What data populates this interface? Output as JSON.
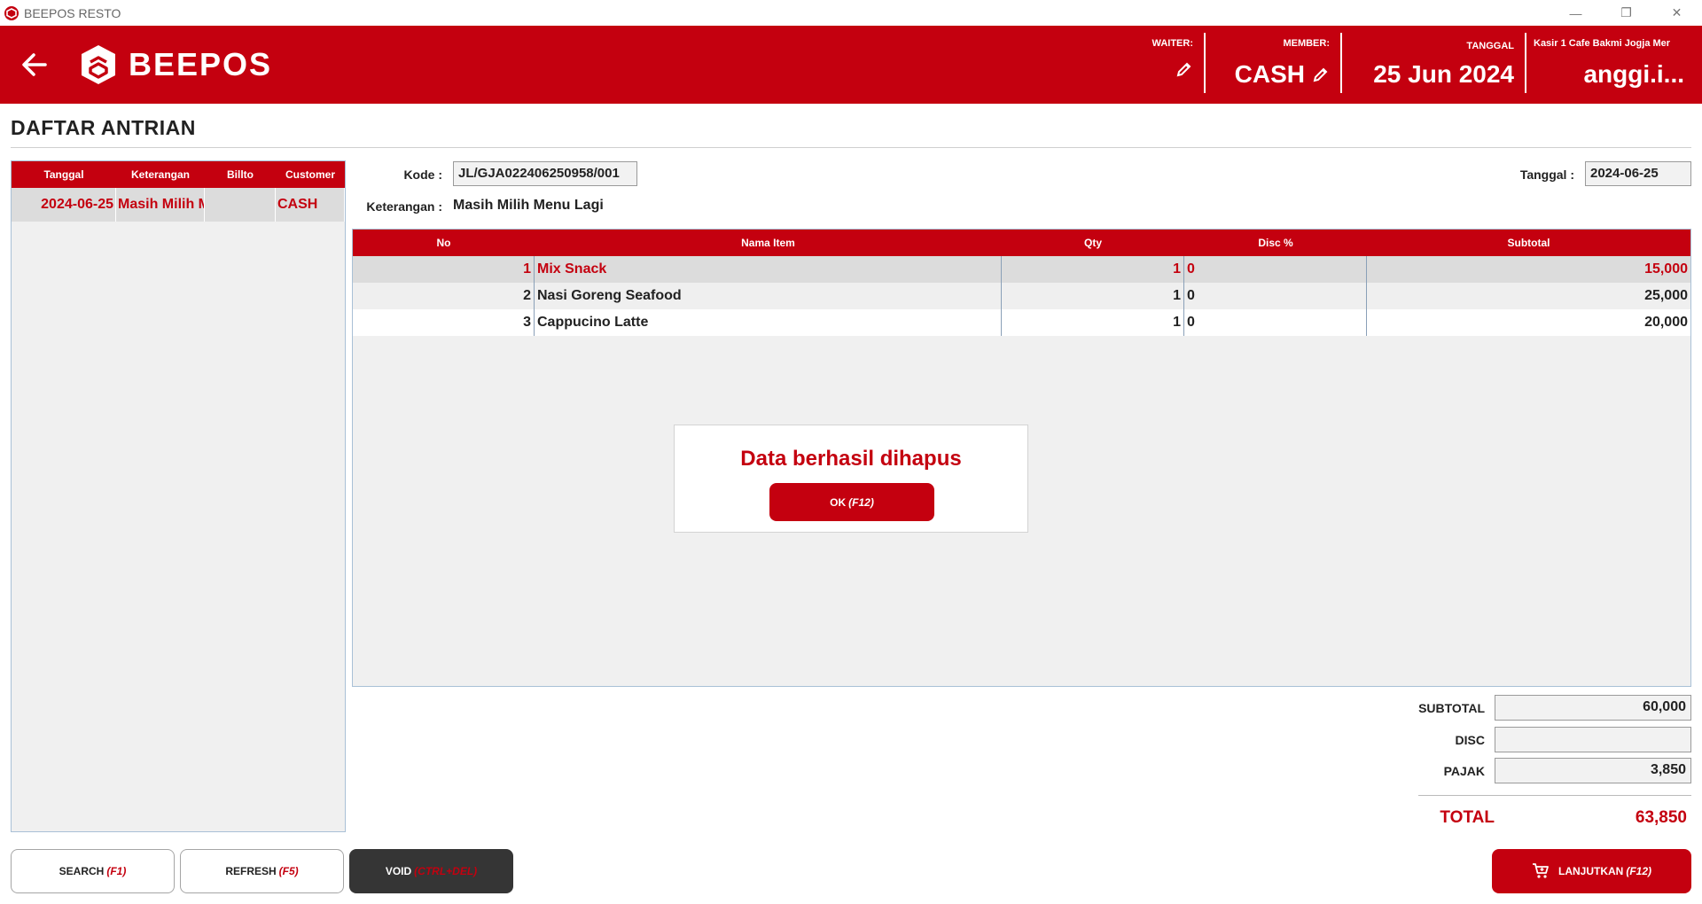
{
  "window": {
    "title": "BEEPOS RESTO",
    "controls": [
      "—",
      "❐",
      "✕"
    ]
  },
  "header": {
    "logo_text": "BEEPOS",
    "waiter_label": "WAITER:",
    "member_label": "MEMBER:",
    "member_value": "CASH",
    "tanggal_label": "TANGGAL",
    "tanggal_value": "25 Jun 2024",
    "kasir_label": "Kasir 1 Cafe Bakmi Jogja Mer",
    "user_value": "anggi.i..."
  },
  "page": {
    "title": "DAFTAR ANTRIAN"
  },
  "queue": {
    "columns": [
      "Tanggal",
      "Keterangan",
      "Billto",
      "Customer"
    ],
    "rows": [
      {
        "tanggal": "2024-06-25",
        "keterangan": "Masih Milih Menu Lagi",
        "billto": "",
        "customer": "CASH"
      }
    ]
  },
  "form": {
    "kode_label": "Kode :",
    "kode_value": "JL/GJA022406250958/001",
    "keterangan_label": "Keterangan :",
    "keterangan_value": "Masih Milih Menu Lagi",
    "tanggal_label": "Tanggal :",
    "tanggal_value": "2024-06-25"
  },
  "items": {
    "columns": [
      "No",
      "Nama Item",
      "Qty",
      "Disc %",
      "Subtotal"
    ],
    "rows": [
      {
        "no": "1",
        "nama": "Mix Snack",
        "qty": "1",
        "disc": "0",
        "subtotal": "15,000"
      },
      {
        "no": "2",
        "nama": "Nasi Goreng Seafood",
        "qty": "1",
        "disc": "0",
        "subtotal": "25,000"
      },
      {
        "no": "3",
        "nama": "Cappucino Latte",
        "qty": "1",
        "disc": "0",
        "subtotal": "20,000"
      }
    ]
  },
  "dialog": {
    "message": "Data berhasil dihapus",
    "ok_label": "OK",
    "ok_shortcut": "(F12)"
  },
  "totals": {
    "subtotal_label": "SUBTOTAL",
    "subtotal_value": "60,000",
    "disc_label": "DISC",
    "disc_value": "",
    "pajak_label": "PAJAK",
    "pajak_value": "3,850",
    "total_label": "TOTAL",
    "total_value": "63,850"
  },
  "buttons": {
    "search_label": "SEARCH",
    "search_shortcut": "(F1)",
    "refresh_label": "REFRESH",
    "refresh_shortcut": "(F5)",
    "void_label": "VOID",
    "void_shortcut": "(CTRL+DEL)",
    "lanjutkan_label": "LANJUTKAN",
    "lanjutkan_shortcut": "(F12)"
  },
  "colors": {
    "brand": "#c4000f",
    "dark_button": "#353535"
  }
}
